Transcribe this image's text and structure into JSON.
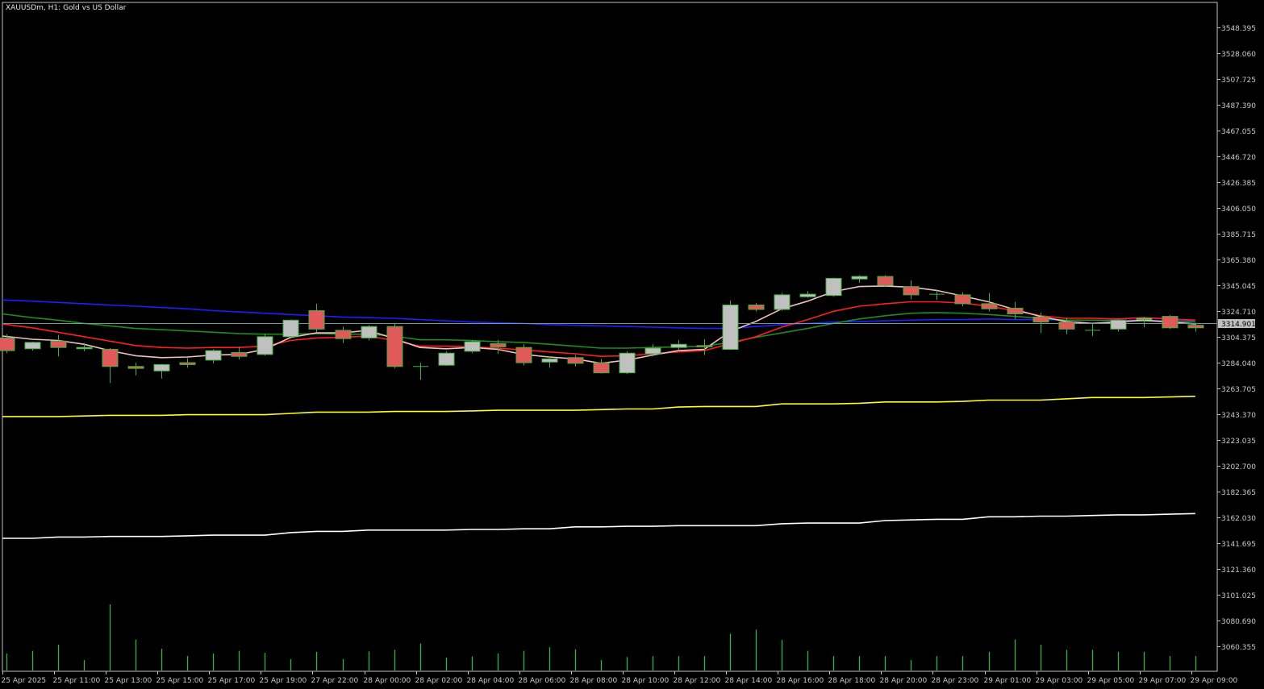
{
  "header": {
    "symbol": "XAUUSDm",
    "timeframe": "H1:",
    "description": "Gold vs US Dollar"
  },
  "current_price_label": "3314.901",
  "colors": {
    "background": "#000000",
    "frame": "#c0c0c0",
    "bull_body": "#c0c0c0",
    "bear_body": "#e05a5a",
    "candle_outline": "#3cb43c",
    "wick": "#3cb43c",
    "volume": "#3cb43c",
    "current_price_line": "#6e9a9a",
    "ma_fast": "#f0c0c0",
    "ma_red": "#ff1e1e",
    "ma_green": "#1e8c1e",
    "ma_blue": "#1e1eff",
    "ma_yellow": "#ffff1e",
    "ma_white": "#ffffff"
  },
  "chart_data": {
    "type": "candlestick",
    "y_ticks": [
      "3548.395",
      "3528.060",
      "3507.725",
      "3487.390",
      "3467.055",
      "3446.720",
      "3426.385",
      "3406.050",
      "3385.715",
      "3365.380",
      "3345.045",
      "3324.710",
      "3304.375",
      "3284.040",
      "3263.705",
      "3243.370",
      "3223.035",
      "3202.700",
      "3182.365",
      "3162.030",
      "3141.695",
      "3121.360",
      "3101.025",
      "3080.690",
      "3060.355"
    ],
    "ylim": [
      3040,
      3570
    ],
    "x_labels": [
      "25 Apr 2025",
      "25 Apr 11:00",
      "25 Apr 13:00",
      "25 Apr 15:00",
      "25 Apr 17:00",
      "25 Apr 19:00",
      "27 Apr 22:00",
      "28 Apr 00:00",
      "28 Apr 02:00",
      "28 Apr 04:00",
      "28 Apr 06:00",
      "28 Apr 08:00",
      "28 Apr 10:00",
      "28 Apr 12:00",
      "28 Apr 14:00",
      "28 Apr 16:00",
      "28 Apr 18:00",
      "28 Apr 20:00",
      "28 Apr 23:00",
      "29 Apr 01:00",
      "29 Apr 03:00",
      "29 Apr 05:00",
      "29 Apr 07:00",
      "29 Apr 09:00"
    ],
    "candles": [
      {
        "o": 3303.5,
        "h": 3306.5,
        "c": 3293.5,
        "l": 3291.5
      },
      {
        "o": 3295.0,
        "h": 3300.5,
        "c": 3300.0,
        "l": 3293.5
      },
      {
        "o": 3301.0,
        "h": 3306.0,
        "c": 3296.0,
        "l": 3289.0
      },
      {
        "o": 3295.0,
        "h": 3299.5,
        "c": 3296.0,
        "l": 3293.0
      },
      {
        "o": 3294.5,
        "h": 3295.5,
        "c": 3281.0,
        "l": 3268.0
      },
      {
        "o": 3281.0,
        "h": 3284.0,
        "c": 3279.5,
        "l": 3274.0
      },
      {
        "o": 3277.5,
        "h": 3283.0,
        "c": 3282.5,
        "l": 3271.5
      },
      {
        "o": 3284.0,
        "h": 3287.5,
        "c": 3282.5,
        "l": 3280.0
      },
      {
        "o": 3286.0,
        "h": 3294.5,
        "c": 3293.5,
        "l": 3283.5
      },
      {
        "o": 3292.0,
        "h": 3296.5,
        "c": 3289.0,
        "l": 3286.5
      },
      {
        "o": 3290.5,
        "h": 3307.0,
        "c": 3304.5,
        "l": 3289.5
      },
      {
        "o": 3304.5,
        "h": 3318.0,
        "c": 3317.5,
        "l": 3303.0
      },
      {
        "o": 3325.0,
        "h": 3330.5,
        "c": 3310.5,
        "l": 3308.0
      },
      {
        "o": 3309.5,
        "h": 3312.5,
        "c": 3303.0,
        "l": 3299.5
      },
      {
        "o": 3303.5,
        "h": 3313.5,
        "c": 3312.5,
        "l": 3301.5
      },
      {
        "o": 3312.5,
        "h": 3315.0,
        "c": 3281.0,
        "l": 3279.5
      },
      {
        "o": 3281.0,
        "h": 3284.0,
        "c": 3280.5,
        "l": 3270.5
      },
      {
        "o": 3282.0,
        "h": 3293.0,
        "c": 3291.5,
        "l": 3281.5
      },
      {
        "o": 3293.0,
        "h": 3302.0,
        "c": 3300.5,
        "l": 3291.5
      },
      {
        "o": 3299.0,
        "h": 3302.0,
        "c": 3296.5,
        "l": 3291.0
      },
      {
        "o": 3296.0,
        "h": 3298.5,
        "c": 3284.0,
        "l": 3282.0
      },
      {
        "o": 3284.5,
        "h": 3289.0,
        "c": 3287.0,
        "l": 3280.0
      },
      {
        "o": 3288.0,
        "h": 3290.0,
        "c": 3283.5,
        "l": 3281.0
      },
      {
        "o": 3284.0,
        "h": 3287.0,
        "c": 3276.0,
        "l": 3275.5
      },
      {
        "o": 3276.0,
        "h": 3293.0,
        "c": 3291.5,
        "l": 3275.0
      },
      {
        "o": 3291.0,
        "h": 3298.5,
        "c": 3295.5,
        "l": 3289.0
      },
      {
        "o": 3296.0,
        "h": 3302.0,
        "c": 3298.5,
        "l": 3293.5
      },
      {
        "o": 3297.5,
        "h": 3302.5,
        "c": 3296.5,
        "l": 3290.0
      },
      {
        "o": 3294.5,
        "h": 3333.0,
        "c": 3329.5,
        "l": 3294.0
      },
      {
        "o": 3329.5,
        "h": 3331.0,
        "c": 3326.0,
        "l": 3324.5
      },
      {
        "o": 3326.0,
        "h": 3339.0,
        "c": 3337.5,
        "l": 3325.0
      },
      {
        "o": 3336.0,
        "h": 3340.5,
        "c": 3338.0,
        "l": 3335.0
      },
      {
        "o": 3337.0,
        "h": 3351.0,
        "c": 3350.5,
        "l": 3336.0
      },
      {
        "o": 3350.0,
        "h": 3353.0,
        "c": 3352.0,
        "l": 3347.0
      },
      {
        "o": 3352.0,
        "h": 3353.0,
        "c": 3345.0,
        "l": 3343.5
      },
      {
        "o": 3344.0,
        "h": 3349.0,
        "c": 3337.5,
        "l": 3334.0
      },
      {
        "o": 3337.5,
        "h": 3341.0,
        "c": 3338.0,
        "l": 3333.5
      },
      {
        "o": 3337.5,
        "h": 3339.5,
        "c": 3330.5,
        "l": 3328.5
      },
      {
        "o": 3330.5,
        "h": 3339.0,
        "c": 3326.5,
        "l": 3324.5
      },
      {
        "o": 3327.0,
        "h": 3332.0,
        "c": 3322.5,
        "l": 3318.5
      },
      {
        "o": 3320.0,
        "h": 3323.5,
        "c": 3316.0,
        "l": 3307.5
      },
      {
        "o": 3316.0,
        "h": 3319.5,
        "c": 3310.5,
        "l": 3306.5
      },
      {
        "o": 3309.0,
        "h": 3314.5,
        "c": 3309.5,
        "l": 3305.0
      },
      {
        "o": 3310.5,
        "h": 3318.5,
        "c": 3317.5,
        "l": 3308.5
      },
      {
        "o": 3318.0,
        "h": 3320.0,
        "c": 3319.0,
        "l": 3312.0
      },
      {
        "o": 3320.5,
        "h": 3321.5,
        "c": 3311.5,
        "l": 3310.5
      },
      {
        "o": 3313.5,
        "h": 3315.5,
        "c": 3311.5,
        "l": 3308.5
      }
    ],
    "volume": [
      33,
      38,
      50,
      20,
      128,
      60,
      42,
      28,
      33,
      38,
      34,
      22,
      36,
      22,
      37,
      40,
      52,
      25,
      27,
      33,
      38,
      45,
      41,
      20,
      26,
      28,
      28,
      28,
      71,
      79,
      59,
      38,
      28,
      28,
      28,
      20,
      28,
      28,
      36,
      60,
      50,
      40,
      40,
      36,
      36,
      28,
      28
    ],
    "volume_max": 128,
    "ma_lines": [
      {
        "color_key": "ma_blue",
        "values": [
          3333.5,
          3332.5,
          3331.5,
          3330.5,
          3329.5,
          3328.5,
          3327.5,
          3326.5,
          3325.0,
          3324.0,
          3323.0,
          3322.0,
          3321.0,
          3320.0,
          3319.5,
          3319.0,
          3318.0,
          3317.0,
          3316.0,
          3315.5,
          3315.0,
          3314.0,
          3313.5,
          3313.0,
          3312.5,
          3312.0,
          3311.5,
          3311.0,
          3311.0,
          3312.5,
          3314.0,
          3315.0,
          3316.0,
          3316.5,
          3317.0,
          3317.5,
          3318.0,
          3318.0,
          3318.5,
          3318.0,
          3318.0,
          3317.5,
          3317.5,
          3317.5,
          3317.5,
          3317.0,
          3317.0
        ]
      },
      {
        "color_key": "ma_green",
        "values": [
          3322.5,
          3319.5,
          3317.5,
          3315.0,
          3313.0,
          3311.0,
          3310.0,
          3309.0,
          3308.0,
          3307.0,
          3306.5,
          3306.5,
          3307.0,
          3306.5,
          3306.5,
          3305.0,
          3302.0,
          3302.0,
          3301.5,
          3300.5,
          3300.0,
          3298.5,
          3297.0,
          3295.5,
          3295.5,
          3296.0,
          3296.5,
          3297.0,
          3300.0,
          3304.0,
          3307.5,
          3311.0,
          3315.0,
          3318.5,
          3321.0,
          3323.0,
          3323.5,
          3323.0,
          3322.0,
          3320.5,
          3319.0,
          3317.5,
          3317.5,
          3317.0,
          3317.0,
          3316.5,
          3316.0
        ]
      },
      {
        "color_key": "ma_red",
        "values": [
          3314.5,
          3311.5,
          3308.0,
          3304.5,
          3301.0,
          3297.5,
          3296.0,
          3295.5,
          3296.0,
          3296.0,
          3297.0,
          3301.5,
          3303.5,
          3304.0,
          3305.0,
          3301.5,
          3297.0,
          3297.0,
          3296.5,
          3295.5,
          3294.0,
          3292.5,
          3291.0,
          3289.0,
          3289.5,
          3291.0,
          3292.5,
          3293.5,
          3299.0,
          3304.5,
          3312.0,
          3318.0,
          3324.5,
          3328.5,
          3330.5,
          3332.0,
          3332.0,
          3331.0,
          3328.5,
          3325.0,
          3321.0,
          3319.0,
          3319.0,
          3318.5,
          3319.5,
          3318.5,
          3317.5
        ]
      },
      {
        "color_key": "ma_fast",
        "values": [
          3305.0,
          3302.5,
          3301.5,
          3298.5,
          3293.5,
          3289.5,
          3288.0,
          3288.5,
          3290.0,
          3290.5,
          3294.5,
          3304.0,
          3307.5,
          3307.5,
          3309.5,
          3303.0,
          3296.0,
          3295.0,
          3296.0,
          3294.5,
          3290.5,
          3288.5,
          3287.0,
          3283.5,
          3286.0,
          3290.0,
          3293.5,
          3294.5,
          3308.5,
          3316.5,
          3326.5,
          3332.5,
          3340.0,
          3344.0,
          3344.5,
          3343.5,
          3341.0,
          3336.5,
          3332.0,
          3326.0,
          3320.5,
          3316.5,
          3315.0,
          3316.0,
          3317.5,
          3316.0,
          3314.5
        ]
      },
      {
        "color_key": "ma_yellow",
        "values": [
          3241.5,
          3241.5,
          3241.5,
          3242.0,
          3242.5,
          3242.5,
          3242.5,
          3243.0,
          3243.0,
          3243.0,
          3243.0,
          3244.0,
          3245.0,
          3245.0,
          3245.0,
          3245.5,
          3245.5,
          3245.5,
          3246.0,
          3246.5,
          3246.5,
          3246.5,
          3246.5,
          3247.0,
          3247.5,
          3247.5,
          3249.0,
          3249.5,
          3249.5,
          3249.5,
          3251.5,
          3251.5,
          3251.5,
          3252.0,
          3253.0,
          3253.0,
          3253.0,
          3253.5,
          3254.5,
          3254.5,
          3254.5,
          3255.5,
          3256.5,
          3256.5,
          3256.5,
          3257.0,
          3257.5
        ]
      },
      {
        "color_key": "ma_white",
        "values": [
          3145.5,
          3145.5,
          3146.5,
          3146.5,
          3147.0,
          3147.0,
          3147.0,
          3147.5,
          3148.0,
          3148.0,
          3148.0,
          3150.0,
          3151.0,
          3151.0,
          3152.0,
          3152.0,
          3152.0,
          3152.0,
          3152.5,
          3152.5,
          3153.0,
          3153.0,
          3154.5,
          3154.5,
          3155.0,
          3155.0,
          3155.5,
          3155.5,
          3155.5,
          3155.5,
          3157.0,
          3157.5,
          3157.5,
          3157.5,
          3159.5,
          3160.0,
          3160.5,
          3160.5,
          3162.5,
          3162.5,
          3163.0,
          3163.0,
          3163.5,
          3164.0,
          3164.0,
          3164.5,
          3165.0
        ]
      }
    ],
    "current_price": 3314.901
  }
}
